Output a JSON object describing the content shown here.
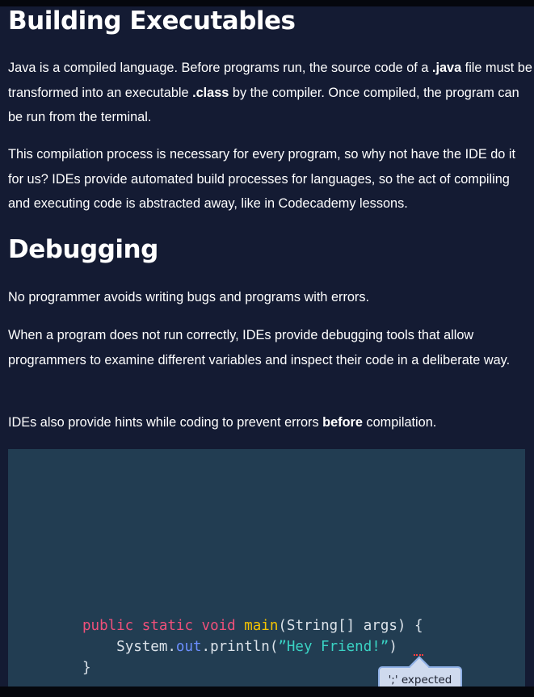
{
  "sections": {
    "building": {
      "heading": "Building Executables",
      "p1": {
        "a": "Java is a compiled language. Before programs run, the source code of a ",
        "b1": ".java",
        "c": " file must be transformed into an executable ",
        "b2": ".class",
        "d": " by the compiler. Once compiled, the program can be run from the terminal."
      },
      "p2": "This compilation process is necessary for every program, so why not have the IDE do it for us? IDEs provide automated build processes for languages, so the act of compiling and executing code is abstracted away, like in Codecademy lessons."
    },
    "debugging": {
      "heading": "Debugging",
      "p1": "No programmer avoids writing bugs and programs with errors.",
      "p2": "When a program does not run correctly, IDEs provide debugging tools that allow programmers to examine different variables and inspect their code in a deliberate way.",
      "p3": {
        "a": "IDEs also provide hints while coding to prevent errors ",
        "b": "before",
        "c": " compilation."
      }
    }
  },
  "code_example": {
    "line1": {
      "kw_public": "public",
      "kw_static": "static",
      "kw_void": "void",
      "method": "main",
      "params": "(String[] args) {"
    },
    "line2": {
      "indent": "    ",
      "obj": "System.",
      "field": "out",
      "call": ".println(",
      "string": "”Hey Friend!”",
      "close": ")"
    },
    "line3": "}",
    "tooltip": "';' expected",
    "colors": {
      "background": "#223d52",
      "keyword": "#f0507a",
      "method": "#f5c400",
      "string": "#3ad3c4",
      "field": "#6c8fff",
      "error_squiggle": "#ff3d3d"
    }
  }
}
